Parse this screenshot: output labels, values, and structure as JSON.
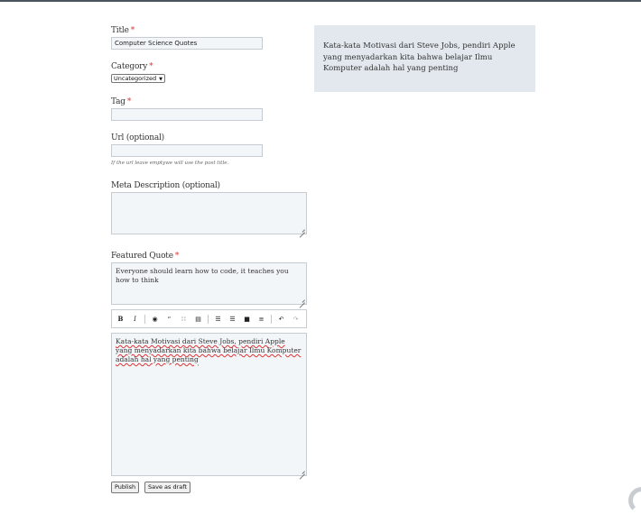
{
  "form": {
    "title_label": "Title",
    "title_value": "Computer Science Quotes",
    "category_label": "Category",
    "category_value": "Uncategorized",
    "tag_label": "Tag",
    "tag_value": "",
    "url_label": "Url (optional)",
    "url_value": "",
    "url_help": "If the url leave emptywe will use the post title.",
    "meta_label": "Meta Description (optional)",
    "meta_value": "",
    "quote_label": "Featured Quote",
    "quote_value": "Everyone should learn how to code, it teaches you how to think",
    "required_mark": "*",
    "editor_content": "Kata-kata Motivasi dari Steve Jobs, pendiri Apple yang menyadarkan kita bahwa belajar Ilmu Komputer adalah hal yang penting",
    "publish_label": "Publish",
    "draft_label": "Save as draft"
  },
  "toolbar": {
    "icons": [
      "bold-icon",
      "italic-icon",
      "link-icon",
      "blockquote-icon",
      "code-icon",
      "image-icon",
      "ordered-list-icon",
      "unordered-list-icon",
      "heading-icon",
      "horizontal-rule-icon",
      "undo-icon",
      "redo-icon"
    ],
    "glyphs": {
      "bold": "B",
      "italic": "I",
      "link": "◉",
      "quote": "“",
      "code": "∷",
      "image": "▤",
      "ol": "☰",
      "ul": "☰",
      "heading": "■",
      "hr": "≡",
      "undo": "↶",
      "redo": "↷"
    }
  },
  "preview": {
    "text": "Kata-kata Motivasi dari Steve Jobs, pendiri Apple yang menyadarkan kita bahwa belajar Ilmu Komputer adalah hal yang penting"
  },
  "colors": {
    "required": "#dd3333",
    "input_bg": "#f3f6f9",
    "preview_bg": "#e2e8ee"
  }
}
